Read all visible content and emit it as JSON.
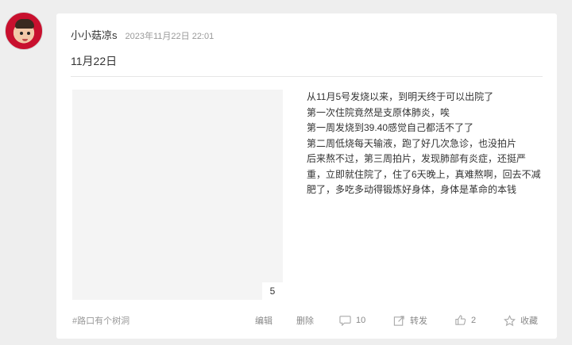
{
  "post": {
    "author": "小小菇凉s",
    "timestamp": "2023年11月22日 22:01",
    "title": "11月22日",
    "image_count": "5",
    "lines": [
      "从11月5号发烧以来，到明天终于可以出院了",
      "第一次住院竟然是支原体肺炎，唉",
      "第一周发烧到39.40感觉自己都活不了了",
      "第二周低烧每天输液，跑了好几次急诊，也没拍片",
      "后来熬不过，第三周拍片，发现肺部有炎症，还挺严重，立即就住院了，住了6天晚上，真难熬啊，回去不减肥了，多吃多动得锻炼好身体，身体是革命的本钱"
    ]
  },
  "footer": {
    "tag": "#路口有个树洞",
    "edit_label": "编辑",
    "delete_label": "删除",
    "comment_count": "10",
    "repost_label": "转发",
    "like_count": "2",
    "favorite_label": "收藏"
  },
  "icons": {
    "avatar": "baby-avatar",
    "comment": "comment-icon",
    "repost": "repost-icon",
    "like": "thumbs-up-icon",
    "favorite": "star-icon"
  }
}
